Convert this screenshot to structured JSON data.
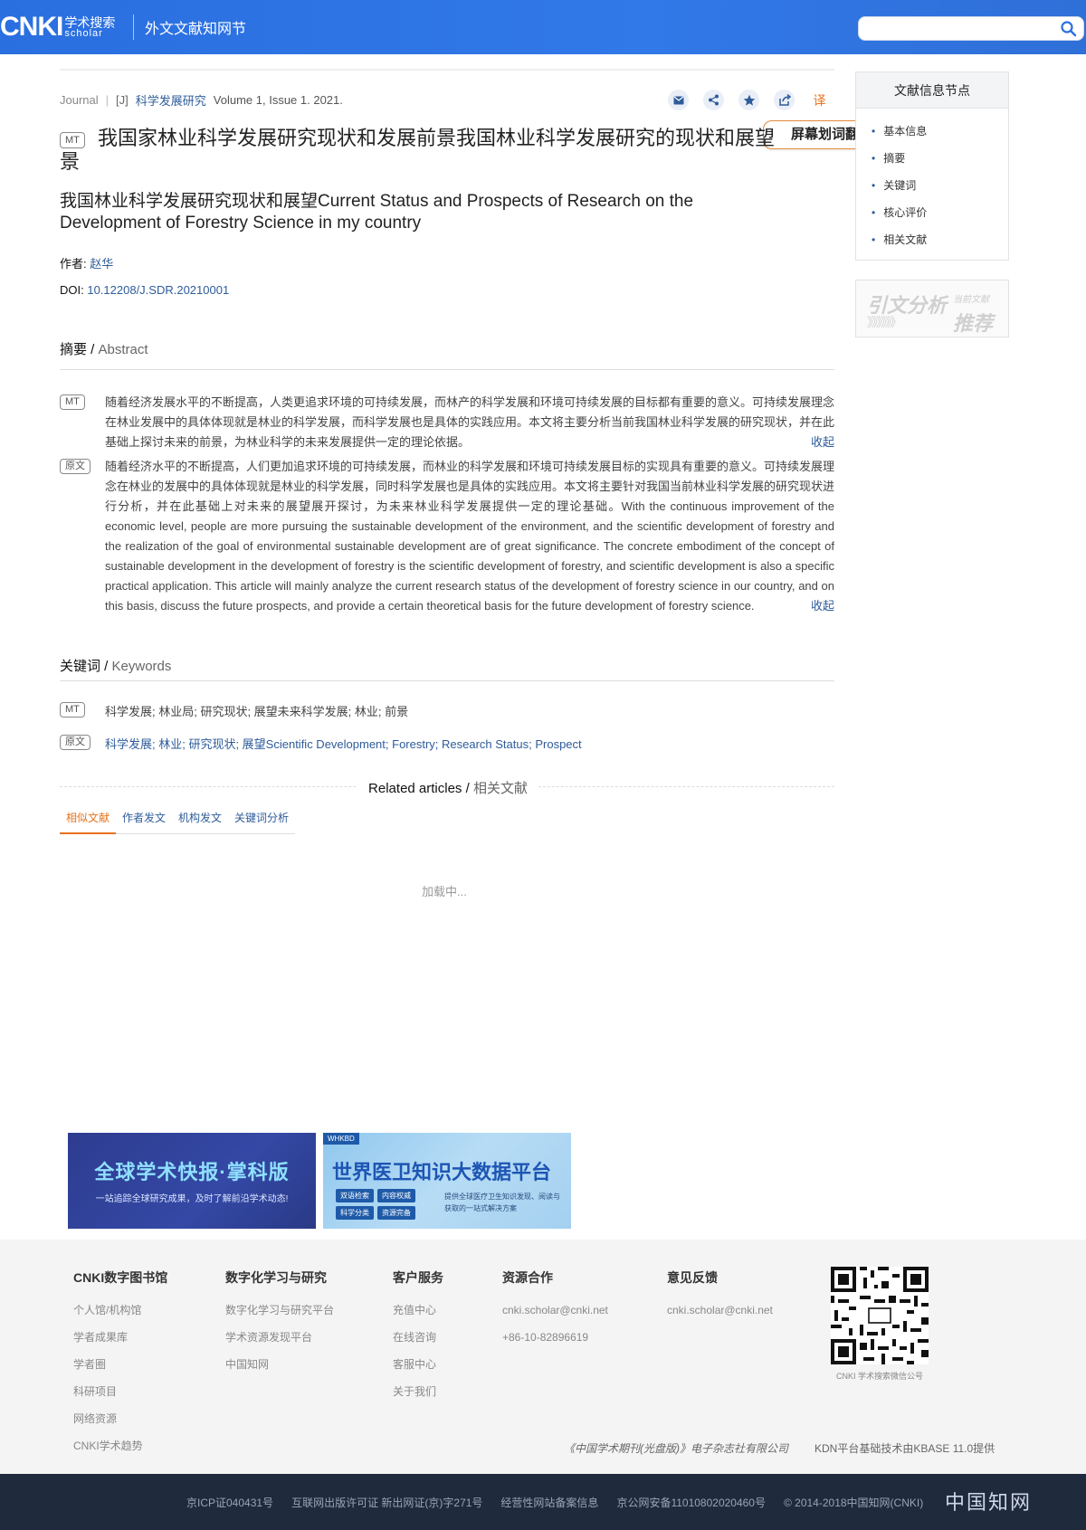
{
  "header": {
    "logo_main": "CNKI",
    "logo_cn": "学术搜索",
    "logo_en": "scholar",
    "site_name": "外文文献知网节",
    "search_placeholder": ""
  },
  "meta": {
    "type": "Journal",
    "separator": "|",
    "jtype": "[J]",
    "journal": "科学发展研究",
    "volume": "Volume 1, Issue 1. 2021."
  },
  "actions": {
    "translate_label": "译",
    "tooltip": "屏幕划词翻译"
  },
  "article": {
    "mt_badge": "MT",
    "title": "我国家林业科学发展研究现状和发展前景我国林业科学发展研究的现状和展望景",
    "subtitle": "我国林业科学发展研究现状和展望Current Status and Prospects of Research on the Development of Forestry Science in my country",
    "author_label": "作者: ",
    "author": "赵华",
    "doi_label": "DOI: ",
    "doi": "10.12208/J.SDR.20210001"
  },
  "abstract": {
    "title_cn": "摘要 / ",
    "title_en": "Abstract",
    "mt_badge": "MT",
    "mt_text": "随着经济发展水平的不断提高，人类更追求环境的可持续发展，而林产的科学发展和环境可持续发展的目标都有重要的意义。可持续发展理念在林业发展中的具体体现就是林业的科学发展，而科学发展也是具体的实践应用。本文将主要分析当前我国林业科学发展的研究现状，并在此基础上探讨未来的前景，为林业科学的未来发展提供一定的理论依据。",
    "orig_badge": "原文",
    "orig_text": "随着经济水平的不断提高，人们更加追求环境的可持续发展，而林业的科学发展和环境可持续发展目标的实现具有重要的意义。可持续发展理念在林业的发展中的具体体现就是林业的科学发展，同时科学发展也是具体的实践应用。本文将主要针对我国当前林业科学发展的研究现状进行分析，并在此基础上对未来的展望展开探讨，为未来林业科学发展提供一定的理论基础。With the continuous improvement of the economic level, people are more pursuing the sustainable development of the environment, and the scientific development of forestry and the realization of the goal of environmental sustainable development are of great significance. The concrete embodiment of the concept of sustainable development in the development of forestry is the scientific development of forestry, and scientific development is also a specific practical application. This article will mainly analyze the current research status of the development of forestry science in our country, and on this basis, discuss the future prospects, and provide a certain theoretical basis for the future development of forestry science.",
    "collapse": "收起"
  },
  "keywords": {
    "title_cn": "关键词 / ",
    "title_en": "Keywords",
    "mt_badge": "MT",
    "mt_text": "科学发展; 林业局; 研究现状; 展望未来科学发展; 林业; 前景",
    "orig_badge": "原文",
    "orig_text": "科学发展; 林业; 研究现状; 展望Scientific Development; Forestry; Research Status; Prospect"
  },
  "related": {
    "title_en": "Related articles / ",
    "title_cn": "相关文献",
    "tabs": [
      "相似文献",
      "作者发文",
      "机构发文",
      "关键词分析"
    ],
    "loading": "加载中..."
  },
  "banners": {
    "b1_title": "全球学术快报·掌科版",
    "b1_sub": "一站追踪全球研究成果，及时了解前沿学术动态!",
    "b2_tag": "WHKBD",
    "b2_title": "世界医卫知识大数据平台",
    "b2_chips": [
      "双语检索",
      "内容权威",
      "科学分类",
      "资源完备"
    ],
    "b2_desc": "提供全球医疗卫生知识发现、阅读与获取的一站式解决方案"
  },
  "sidebar": {
    "nav_title": "文献信息节点",
    "items": [
      "基本信息",
      "摘要",
      "关键词",
      "核心评价",
      "相关文献"
    ],
    "banner_a": "引文分析",
    "banner_b": "当前文献",
    "banner_c": "》》》》》》",
    "banner_d": "推荐"
  },
  "footer": {
    "col1": {
      "h": "CNKI数字图书馆",
      "items": [
        "个人馆/机构馆",
        "学者成果库",
        "学者圈",
        "科研项目",
        "网络资源",
        "CNKI学术趋势"
      ]
    },
    "col2": {
      "h": "数字化学习与研究",
      "items": [
        "数字化学习与研究平台",
        "学术资源发现平台",
        "中国知网"
      ]
    },
    "col3": {
      "h": "客户服务",
      "items": [
        "充值中心",
        "在线咨询",
        "客服中心",
        "关于我们"
      ]
    },
    "col4": {
      "h": "资源合作",
      "items": [
        "cnki.scholar@cnki.net",
        "+86-10-82896619"
      ]
    },
    "col5": {
      "h": "意见反馈",
      "items": [
        "cnki.scholar@cnki.net"
      ]
    },
    "qr_caption": "CNKI 学术搜索微信公号",
    "publisher": "《中国学术期刊(光盘版)》电子杂志社有限公司",
    "kdn": "KDN平台基础技术由KBASE 11.0提供",
    "bottom_links": [
      "京ICP证040431号",
      "互联网出版许可证 新出网证(京)字271号",
      "经营性网站备案信息",
      "京公网安备11010802020460号",
      "© 2014-2018中国知网(CNKI)"
    ],
    "brand": "中国知网"
  },
  "colors": {
    "header": "#2a6fe0",
    "link": "#2e5c9a",
    "accent": "#e8731e",
    "bottom_bar": "#1f2a3d"
  }
}
